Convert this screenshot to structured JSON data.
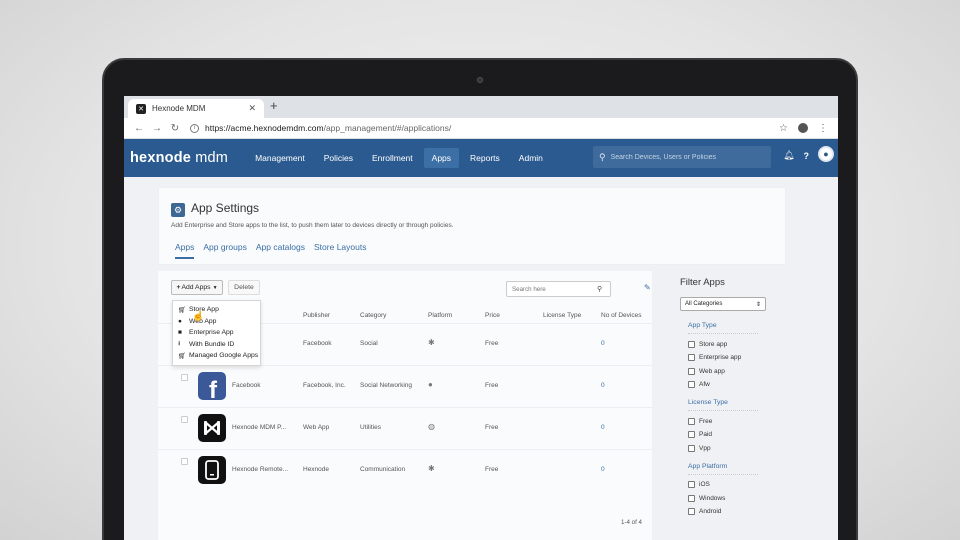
{
  "browser": {
    "tab_title": "Hexnode MDM",
    "url_host": "https://acme.hexnodemdm.com",
    "url_path": "/app_management/#/applications/"
  },
  "header": {
    "logo": "hexnode",
    "logo_suffix": "mdm",
    "nav": [
      "Management",
      "Policies",
      "Enrollment",
      "Apps",
      "Reports",
      "Admin"
    ],
    "active_nav": "Apps",
    "search_placeholder": "Search Devices, Users or Policies"
  },
  "page": {
    "title": "App Settings",
    "subtitle": "Add Enterprise and Store apps to the list, to push them later to devices directly or through policies.",
    "tabs": [
      "Apps",
      "App groups",
      "App catalogs",
      "Store Layouts"
    ],
    "active_tab": "Apps"
  },
  "toolbar": {
    "add_label": "Add Apps",
    "delete_label": "Delete",
    "search_placeholder": "Search here"
  },
  "dropdown": {
    "items": [
      "Store App",
      "Web App",
      "Enterprise App",
      "With Bundle ID",
      "Managed Google Apps"
    ]
  },
  "table": {
    "columns": [
      "Publisher",
      "Category",
      "Platform",
      "Price",
      "License Type",
      "No of Devices"
    ],
    "rows": [
      {
        "name": "",
        "publisher": "Facebook",
        "category": "Social",
        "platform": "android",
        "price": "Free",
        "license": "",
        "devices": "0"
      },
      {
        "name": "Facebook",
        "publisher": "Facebook, Inc.",
        "category": "Social Networking",
        "platform": "apple",
        "price": "Free",
        "license": "",
        "devices": "0"
      },
      {
        "name": "Hexnode MDM P...",
        "publisher": "Web App",
        "category": "Utilities",
        "platform": "web",
        "price": "Free",
        "license": "",
        "devices": "0"
      },
      {
        "name": "Hexnode Remote...",
        "publisher": "Hexnode",
        "category": "Communication",
        "platform": "android",
        "price": "Free",
        "license": "",
        "devices": "0"
      }
    ],
    "pagination": "1-4 of 4"
  },
  "filter": {
    "title": "Filter Apps",
    "category_select": "All Categories",
    "groups": [
      {
        "title": "App Type",
        "options": [
          "Store app",
          "Enterprise app",
          "Web app",
          "Afw"
        ]
      },
      {
        "title": "License Type",
        "options": [
          "Free",
          "Paid",
          "Vpp"
        ]
      },
      {
        "title": "App Platform",
        "options": [
          "iOS",
          "Windows",
          "Android"
        ]
      }
    ]
  },
  "colors": {
    "header_bg": "#2a5a8f",
    "accent": "#3a6ea5"
  }
}
